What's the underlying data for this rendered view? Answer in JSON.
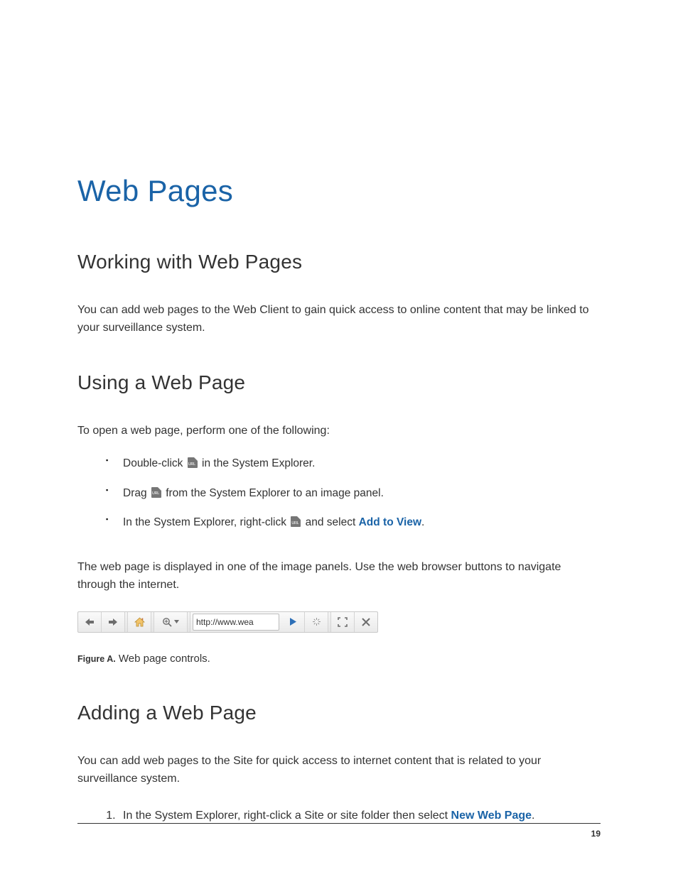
{
  "title": "Web Pages",
  "section1": {
    "heading": "Working with Web Pages",
    "para": "You can add web pages to the Web Client to gain quick access to online content that may be linked to your surveillance system."
  },
  "section2": {
    "heading": "Using a Web Page",
    "intro": "To open a web page, perform one of the following:",
    "bullets": {
      "b1a": "Double-click ",
      "b1b": " in the System Explorer.",
      "b2a": "Drag ",
      "b2b": " from the System Explorer to an image panel.",
      "b3a": "In the System Explorer, right-click ",
      "b3b": " and select ",
      "b3link": "Add to View",
      "b3c": "."
    },
    "after": "The web page is displayed in one of the image panels. Use the web browser buttons to navigate through the internet."
  },
  "toolbar": {
    "url": "http://www.wea"
  },
  "figcap": {
    "label": "Figure A.",
    "text": " Web page controls."
  },
  "section3": {
    "heading": "Adding a Web Page",
    "para": "You can add web pages to the Site for quick access to internet content that is related to your surveillance system.",
    "step1a": "In the System Explorer, right-click a Site or site folder then select ",
    "step1link": "New Web Page",
    "step1b": "."
  },
  "page_number": "19"
}
